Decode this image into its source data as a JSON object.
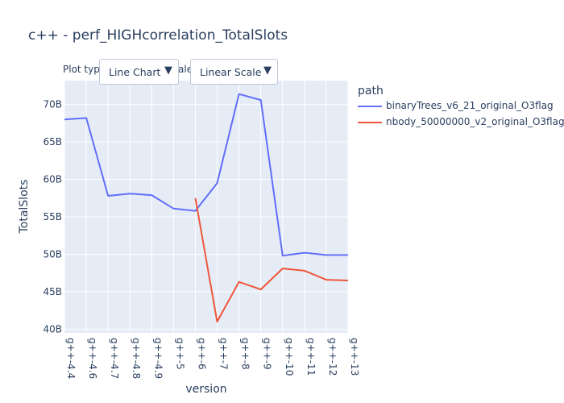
{
  "chart_data": {
    "type": "line",
    "title": "c++ - perf_HIGHcorrelation_TotalSlots",
    "xlabel": "version",
    "ylabel": "TotalSlots",
    "categories": [
      "g++-4.4",
      "g++-4.6",
      "g++-4.7",
      "g++-4.8",
      "g++-4.9",
      "g++-5",
      "g++-6",
      "g++-7",
      "g++-8",
      "g++-9",
      "g++-10",
      "g++-11",
      "g++-12",
      "g++-13"
    ],
    "ylim": [
      39.5,
      73.2
    ],
    "yticks": [
      40,
      45,
      50,
      55,
      60,
      65,
      70
    ],
    "ytick_labels": [
      "40B",
      "45B",
      "50B",
      "55B",
      "60B",
      "65B",
      "70B"
    ],
    "grid": true,
    "legend_title": "path",
    "legend_position": "right",
    "series": [
      {
        "name": "binaryTrees_v6_21_original_O3flag",
        "color": "#636efa",
        "values": [
          68.0,
          68.2,
          57.8,
          58.1,
          57.9,
          56.1,
          55.8,
          59.5,
          71.4,
          70.6,
          49.8,
          50.2,
          49.9,
          49.9
        ]
      },
      {
        "name": "nbody_50000000_v2_original_O3flag",
        "color": "#ef553b",
        "values": [
          null,
          null,
          null,
          null,
          null,
          null,
          57.5,
          41.0,
          46.3,
          45.3,
          48.1,
          47.8,
          46.6,
          46.5
        ]
      }
    ]
  },
  "controls": {
    "plot_type_label": "Plot type:",
    "scale_label_suffix": "ale:",
    "plot_type_value": "Line Chart",
    "scale_value": "Linear Scale",
    "caret": "▼"
  }
}
